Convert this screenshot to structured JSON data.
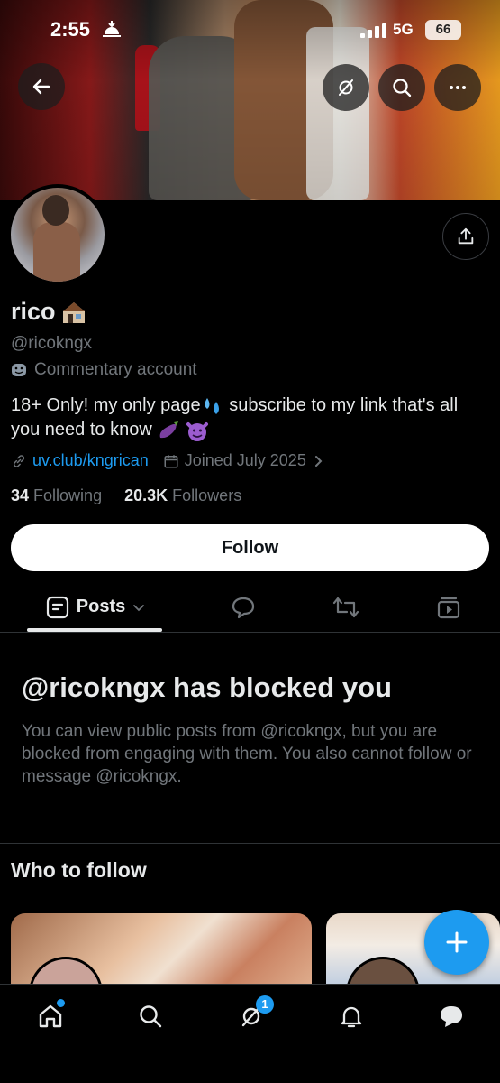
{
  "status_bar": {
    "time": "2:55",
    "network": "5G",
    "battery": "66"
  },
  "profile": {
    "name": "rico",
    "handle": "@ricokngx",
    "category": "Commentary account",
    "bio": "18+ Only! my only page",
    "bio_part2": "subscribe to my link that's all you need to know",
    "link": "uv.club/kngrican",
    "joined": "Joined July 2025",
    "following_count": "34",
    "following_label": "Following",
    "followers_count": "20.3K",
    "followers_label": "Followers"
  },
  "actions": {
    "follow_label": "Follow"
  },
  "tabs": {
    "posts_label": "Posts"
  },
  "blocked": {
    "title": "@ricokngx has blocked you",
    "message": "You can view public posts from @ricokngx, but you are blocked from engaging with them. You also cannot follow or message @ricokngx."
  },
  "who_to_follow": {
    "title": "Who to follow"
  },
  "bottom_nav": {
    "messages_badge": "1"
  },
  "colors": {
    "accent": "#1d9bf0",
    "background": "#000000",
    "text_primary": "#e7e9ea",
    "text_secondary": "#71767b"
  },
  "icons": [
    "back-arrow-icon",
    "grok-icon",
    "search-icon",
    "more-icon",
    "share-icon",
    "home-icon",
    "messages-icon",
    "notifications-icon",
    "chat-icon",
    "compose-icon",
    "link-icon",
    "calendar-icon",
    "chevron-right-icon",
    "comment-icon",
    "repost-icon",
    "video-icon"
  ]
}
